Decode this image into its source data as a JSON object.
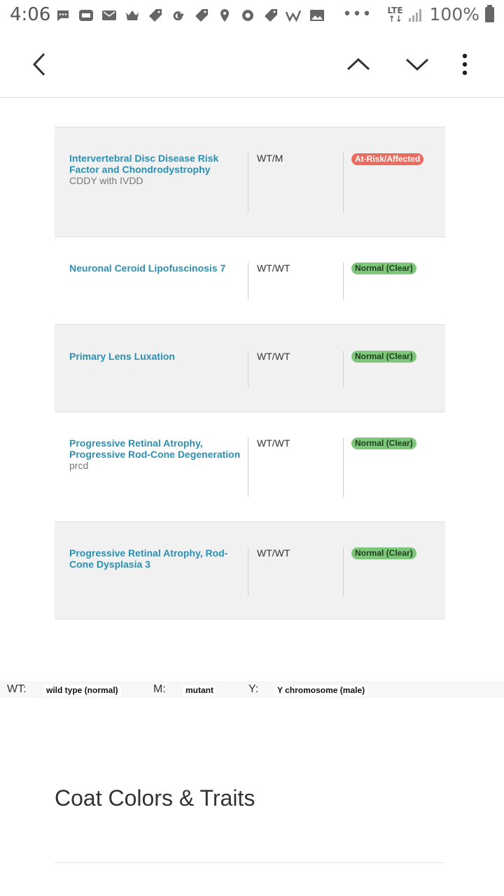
{
  "status_bar": {
    "time": "4:06",
    "network": "LTE",
    "battery": "100%",
    "notification_icons": [
      "messages-icon",
      "letgo-icon",
      "mail-icon",
      "crown-icon",
      "tag-icon",
      "google-icon",
      "tag-icon",
      "location-icon",
      "settings-icon",
      "tag-icon",
      "wish-icon",
      "image-icon"
    ],
    "overflow": "•••"
  },
  "toolbar": {
    "back_icon": "chevron-left-icon",
    "prev_icon": "chevron-up-icon",
    "next_icon": "chevron-down-icon",
    "menu_icon": "more-vert-icon"
  },
  "results": [
    {
      "name": "Intervertebral Disc Disease Risk Factor and Chondrodystrophy",
      "sub": "CDDY with IVDD",
      "genotype": "WT/M",
      "status": "At-Risk/Affected",
      "kind": "risk"
    },
    {
      "name": "Neuronal Ceroid Lipofuscinosis 7",
      "sub": "",
      "genotype": "WT/WT",
      "status": "Normal (Clear)",
      "kind": "clear"
    },
    {
      "name": "Primary Lens Luxation",
      "sub": "",
      "genotype": "WT/WT",
      "status": "Normal (Clear)",
      "kind": "clear"
    },
    {
      "name": "Progressive Retinal Atrophy, Progressive Rod-Cone Degeneration",
      "sub": "prcd",
      "genotype": "WT/WT",
      "status": "Normal (Clear)",
      "kind": "clear"
    },
    {
      "name": "Progressive Retinal Atrophy, Rod-Cone Dysplasia 3",
      "sub": "",
      "genotype": "WT/WT",
      "status": "Normal (Clear)",
      "kind": "clear"
    }
  ],
  "legend": [
    {
      "key": "WT:",
      "value": "wild type (normal)"
    },
    {
      "key": "M:",
      "value": "mutant"
    },
    {
      "key": "Y:",
      "value": "Y chromosome (male)"
    }
  ],
  "section": {
    "title": "Coat Colors & Traits"
  },
  "colors": {
    "link": "#2a8fb0",
    "clear": "#7dc67a",
    "risk": "#ec6b5f",
    "shade": "#f1f1f1"
  }
}
